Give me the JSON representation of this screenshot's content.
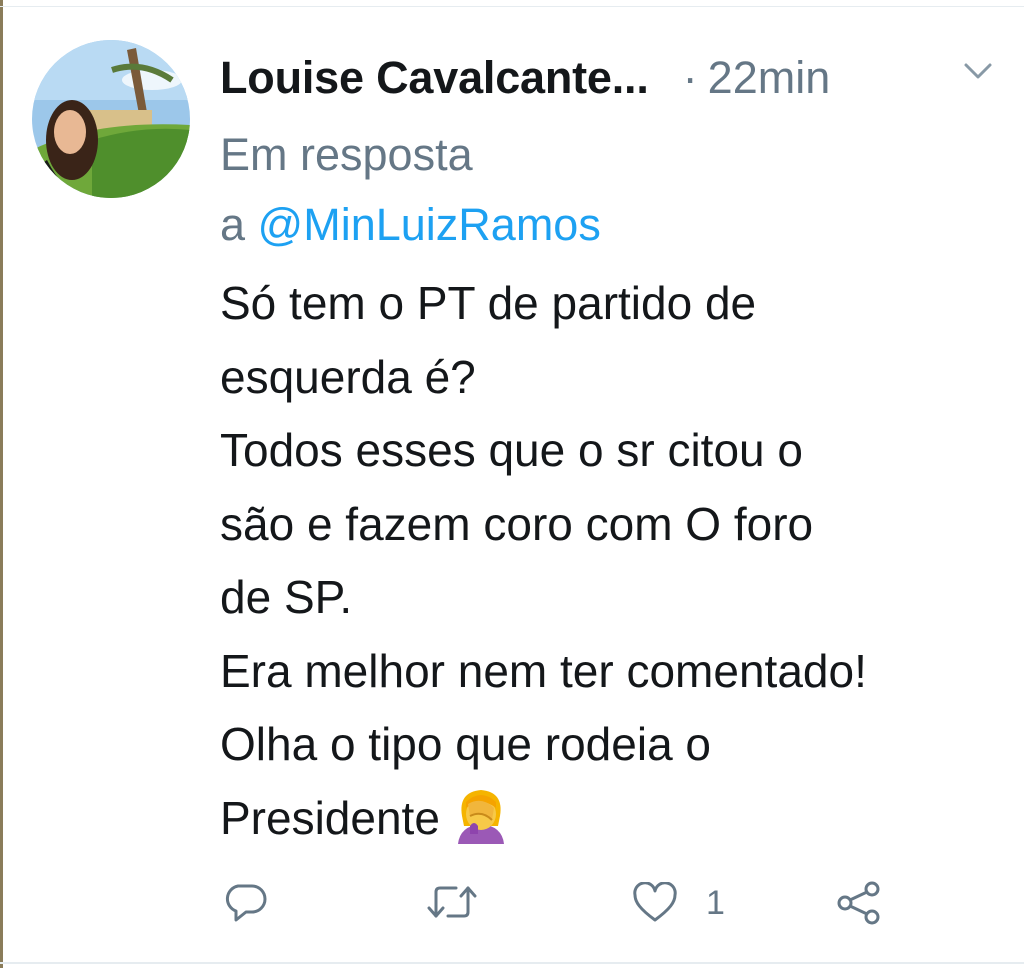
{
  "tweet": {
    "display_name": "Louise Cavalcante...",
    "separator": "·",
    "timestamp": "22min",
    "reply_prefix": "Em resposta",
    "reply_a": "a",
    "reply_mention": "@MinLuizRamos",
    "text_lines": [
      "Só tem o PT de partido de",
      "esquerda é?",
      "Todos esses que o sr citou o",
      "são e fazem coro com O foro",
      "de SP.",
      "Era melhor nem ter comentado!",
      "Olha o tipo que rodeia o",
      "Presidente"
    ],
    "emoji": "woman-facepalming",
    "actions": {
      "reply_icon": "reply-icon",
      "retweet_icon": "retweet-icon",
      "like_icon": "heart-icon",
      "like_count": "1",
      "share_icon": "share-icon"
    }
  },
  "colors": {
    "primary_text": "#14171a",
    "secondary_text": "#657786",
    "link": "#1da1f2"
  }
}
